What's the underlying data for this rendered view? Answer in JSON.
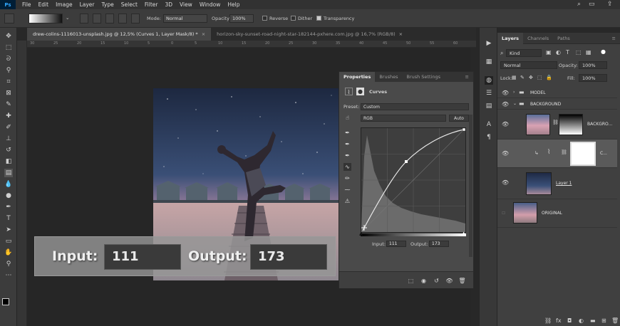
{
  "menu": {
    "items": [
      "File",
      "Edit",
      "Image",
      "Layer",
      "Type",
      "Select",
      "Filter",
      "3D",
      "View",
      "Window",
      "Help"
    ]
  },
  "options": {
    "mode_label": "Mode:",
    "mode_value": "Normal",
    "opacity_label": "Opacity:",
    "opacity_value": "100%",
    "reverse_label": "Reverse",
    "dither_label": "Dither",
    "transparency_label": "Transparency"
  },
  "tabs": [
    {
      "label": "drew-colins-1116013-unsplash.jpg @ 12,5% (Curves 1, Layer Mask/8) *",
      "close": "×"
    },
    {
      "label": "horizon-sky-sunset-road-night-star-182144-pxhere.com.jpg @ 16,7% (RGB/8)",
      "close": "×"
    }
  ],
  "ruler": {
    "ticks": [
      "30",
      "25",
      "20",
      "15",
      "10",
      "5",
      "0",
      "5",
      "10",
      "15",
      "20",
      "25",
      "30",
      "35",
      "40",
      "45",
      "50",
      "55",
      "60"
    ]
  },
  "overlay": {
    "input_label": "Input:",
    "input_value": "111",
    "output_label": "Output:",
    "output_value": "173"
  },
  "properties": {
    "tabs": [
      "Properties",
      "Brushes",
      "Brush Settings"
    ],
    "title": "Curves",
    "preset_label": "Preset:",
    "preset_value": "Custom",
    "channel_value": "RGB",
    "auto_label": "Auto",
    "input_label": "Input:",
    "input_value": "111",
    "output_label": "Output:",
    "output_value": "173"
  },
  "layers": {
    "tabs": [
      "Layers",
      "Channels",
      "Paths"
    ],
    "filter_value": "Kind",
    "blend_value": "Normal",
    "opacity_label": "Opacity:",
    "opacity_value": "100%",
    "lock_label": "Lock:",
    "fill_label": "Fill:",
    "fill_value": "100%",
    "rows": [
      {
        "name": "MODEL"
      },
      {
        "name": "BACKGROUND"
      },
      {
        "name": "BACKGRO..."
      },
      {
        "name": "C..."
      },
      {
        "name": "Layer 1"
      },
      {
        "name": "ORIGINAL"
      }
    ]
  },
  "colors": {
    "accent": "#31a8ff",
    "panel": "#4a4a4a",
    "background": "#282828"
  }
}
